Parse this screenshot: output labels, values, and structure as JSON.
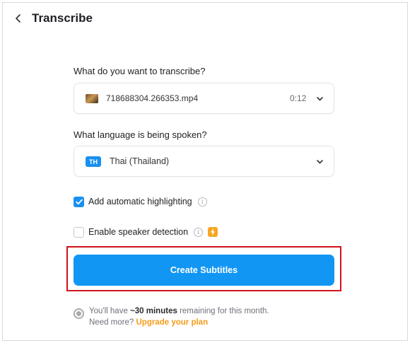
{
  "header": {
    "title": "Transcribe",
    "back_icon": "chevron-left-icon"
  },
  "media": {
    "label": "What do you want to transcribe?",
    "file_name": "718688304.266353.mp4",
    "duration": "0:12",
    "thumbnail_icon": "video-thumbnail"
  },
  "language": {
    "label": "What language is being spoken?",
    "code": "TH",
    "name": "Thai (Thailand)",
    "badge_color": "#1a8ff0"
  },
  "options": {
    "highlighting": {
      "label": "Add automatic highlighting",
      "checked": true
    },
    "speaker_detection": {
      "label": "Enable speaker detection",
      "checked": false,
      "premium_icon": "lightning-bolt-icon"
    }
  },
  "create_button": {
    "label": "Create Subtitles",
    "color": "#1296f3"
  },
  "usage": {
    "prefix": "You'll have",
    "amount": "~30 minutes",
    "suffix": "remaining for this month.",
    "need_more": "Need more?",
    "upgrade_label": "Upgrade your plan",
    "upgrade_color": "#f59c1a"
  }
}
